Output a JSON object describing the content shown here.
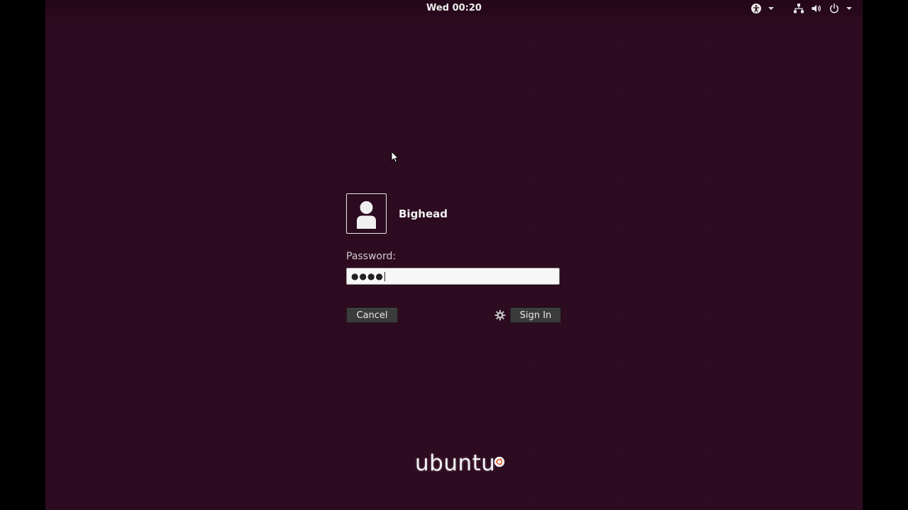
{
  "topbar": {
    "clock": "Wed 00:20",
    "indicators": [
      {
        "icon": "accessibility-icon"
      },
      {
        "icon": "network-icon"
      },
      {
        "icon": "volume-icon"
      },
      {
        "icon": "power-icon"
      }
    ]
  },
  "login": {
    "username": "Bighead",
    "password_label": "Password:",
    "password_masked": "●●●●",
    "cancel_label": "Cancel",
    "signin_label": "Sign In",
    "session_icon": "gear-icon"
  },
  "branding": {
    "logo_text": "ubuntu"
  },
  "colors": {
    "background": "#2c0a1f",
    "topbar": "#240718",
    "text": "#f2f2f2",
    "button": "#3b3b3b",
    "logo_accent": "#e95420"
  }
}
